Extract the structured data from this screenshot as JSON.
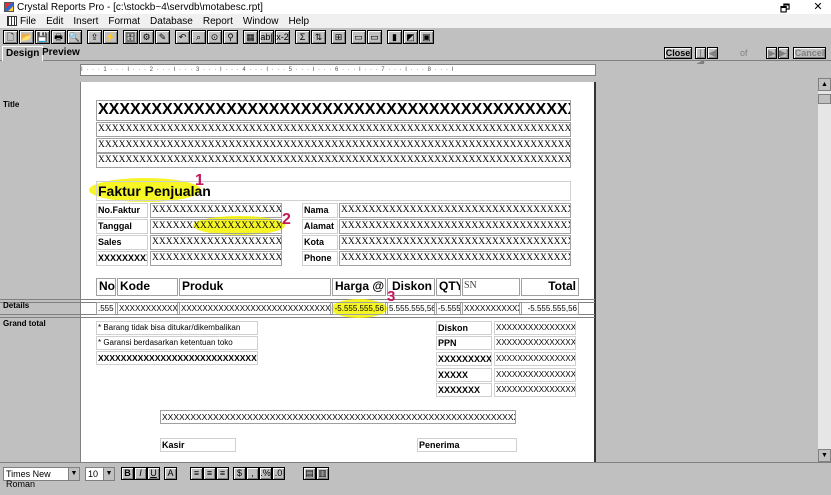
{
  "window": {
    "title": "Crystal Reports Pro - [c:\\stockb~4\\servdb\\motabesc.rpt]",
    "restore_glyph": "🗗",
    "close_glyph": "✕"
  },
  "menu": [
    "File",
    "Edit",
    "Insert",
    "Format",
    "Database",
    "Report",
    "Window",
    "Help"
  ],
  "toolbar_icons": [
    "new-icon",
    "open-icon",
    "save-icon",
    "print-icon",
    "print-preview-icon",
    "export-icon",
    "lightning-icon",
    "insert-database-icon",
    "insert-formula-icon",
    "insert-text-icon",
    "undo-icon",
    "find-icon",
    "search-icon",
    "binoculars-icon",
    "insert-table-icon",
    "abl-icon",
    "xyz-icon",
    "formula-icon",
    "summation-icon",
    "sort-icon",
    "group-icon",
    "subreport-icon",
    "chart-icon",
    "map-icon",
    "ole-icon"
  ],
  "toolbar_glyphs": [
    "🗋",
    "📂",
    "💾",
    "🖶",
    "🔍",
    "⇪",
    "⚡",
    "🗄",
    "⚙",
    "✎",
    "↶",
    "⌕",
    "⊙",
    "⚲",
    "▦",
    "ab|",
    "x-2",
    "Σ",
    "⇅",
    "⊞",
    "▭",
    "▭",
    "▮",
    "◩",
    "▣"
  ],
  "tabs": {
    "design": "Design",
    "preview": "Preview"
  },
  "nav": {
    "close": "Close",
    "first": "|◀",
    "prev": "◀",
    "of": "of",
    "next": "▶",
    "last": "▶|",
    "cancel": "Cancel"
  },
  "ruler": "I · · · 1 · · · I · · · 2 · · · I · · · 3 · · · I · · · 4 · · · I · · · 5 · · · I · · · 6 · · · I · · · 7 · · · I · · · 8 · · · I",
  "sections": {
    "title": "Title",
    "details": "Details",
    "grand_total": "Grand total"
  },
  "report": {
    "title_x1": "XXXXXXXXXXXXXXXXXXXXXXXXXXXXXXXXXXXXXXXXXXXXXXXXX",
    "title_x2": "XXXXXXXXXXXXXXXXXXXXXXXXXXXXXXXXXXXXXXXXXXXXXXXXXXXXXXXXXXXXXXXXXXXXXXXXXXXXXXXX",
    "title_x3": "XXXXXXXXXXXXXXXXXXXXXXXXXXXXXXXXXXXXXXXXXXXXXXXXXXXXXXXXXXXXXXXXXXXXXXXXXXXXXXXX",
    "title_x4": "XXXXXXXXXXXXXXXXXXXXXXXXXXXXXXXXXXXXXXXXXXXXXXXXXXXXXXXXXXXXXXXXXXXXXXXXXXXXXXXX",
    "invoice_title": "Faktur Penjualan",
    "left_labels": [
      "No.Faktur",
      "Tanggal",
      "Sales",
      "XXXXXXXXX"
    ],
    "left_values": [
      "XXXXXXXXXXXXXXXXXXXXXXXXXXXXXXXXX",
      "XXXXXXXXXXXXXXXXXXXXXXXXXXXXXXXXX",
      "XXXXXXXXXXXXXXXXXXXXXXXXXXXXXXXXX",
      "XXXXXXXXXXXXXXXXXXXXXXXXXXXXXXXXX"
    ],
    "right_labels": [
      "Nama",
      "Alamat",
      "Kota",
      "Phone"
    ],
    "right_values": [
      "XXXXXXXXXXXXXXXXXXXXXXXXXXXXXXXXXXXXXXXXXXXXXXXXXXXX",
      "XXXXXXXXXXXXXXXXXXXXXXXXXXXXXXXXXXXXXXXXXXXXXXXXXXXX",
      "XXXXXXXXXXXXXXXXXXXXXXXXXXXXXXXXXXXXXXXXXXXXXXXXXXXX",
      "XXXXXXXXXXXXXXXXXXXXXXXXXXXXXXXXXXXXXXXXXXXXXXXXXXXX"
    ],
    "columns": [
      "No",
      "Kode",
      "Produk",
      "Harga @",
      "Diskon",
      "QTY",
      "SN",
      "Total"
    ],
    "detail_row": [
      ".555",
      "XXXXXXXXXXX",
      "XXXXXXXXXXXXXXXXXXXXXXXXXXXXXXXXXX",
      "-5.555.555,56",
      "5.555.555,56",
      "-5.555",
      "XXXXXXXXXXX",
      "-5.555.555,56"
    ],
    "notes": [
      "* Barang tidak bisa ditukar/dikembalikan",
      "* Garansi berdasarkan ketentuan toko",
      "XXXXXXXXXXXXXXXXXXXXXXXXXXXXXX"
    ],
    "total_labels": [
      "Diskon",
      "PPN",
      "XXXXXXXXXX",
      "XXXXX",
      "XXXXXXX"
    ],
    "total_values": [
      "XXXXXXXXXXXXXXXX",
      "XXXXXXXXXXXXXXXX",
      "XXXXXXXXXXXXXXXX",
      "XXXXXXXXXXXXXXXX",
      "XXXXXXXXXXXXXXXX"
    ],
    "footer_x": "XXXXXXXXXXXXXXXXXXXXXXXXXXXXXXXXXXXXXXXXXXXXXXXXXXXXXXXXXXXXXXXXXXXX",
    "kasir": "Kasir",
    "penerima": "Penerima"
  },
  "annotations": [
    "1",
    "2",
    "3"
  ],
  "colors": {
    "highlight": "#f5f500",
    "annotation": "#c2185b"
  },
  "format_bar": {
    "font": "Times New Roman",
    "size": "10",
    "bold": "B",
    "italic": "I",
    "underline": "U"
  },
  "format_glyphs": [
    "A",
    "≡",
    "≡",
    "≡",
    "$",
    ",",
    ".%",
    ".0",
    "▤",
    "▥"
  ]
}
